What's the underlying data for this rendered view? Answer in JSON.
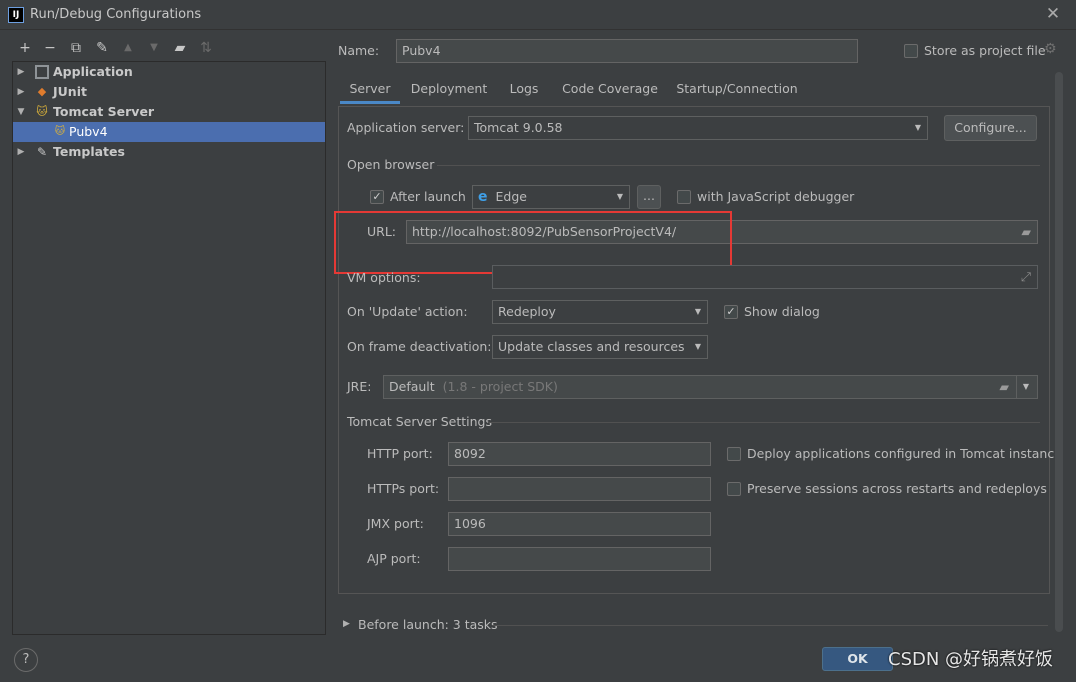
{
  "window": {
    "title": "Run/Debug Configurations",
    "app_icon_text": "IJ"
  },
  "toolbar": {
    "add": "+",
    "remove": "−",
    "copy": "⧉",
    "edit": "✎",
    "up": "▲",
    "down": "▼",
    "folder": "▰",
    "sort": "⇅"
  },
  "tree": {
    "items": [
      {
        "label": "Application",
        "arrow": "▶"
      },
      {
        "label": "JUnit",
        "arrow": "▶"
      },
      {
        "label": "Tomcat Server",
        "arrow": "▼"
      },
      {
        "label": "Pubv4"
      },
      {
        "label": "Templates",
        "arrow": "▶"
      }
    ]
  },
  "name_field": {
    "label": "Name:",
    "value": "Pubv4"
  },
  "store_as_project": {
    "label": "Store as project file",
    "checked": false
  },
  "tabs": [
    "Server",
    "Deployment",
    "Logs",
    "Code Coverage",
    "Startup/Connection"
  ],
  "server": {
    "app_server_label": "Application server:",
    "app_server_value": "Tomcat 9.0.58",
    "configure_label": "Configure...",
    "open_browser_label": "Open browser",
    "after_launch_label": "After launch",
    "browser_value": "Edge",
    "ellipsis_label": "...",
    "js_debugger_label": "with JavaScript debugger",
    "url_label": "URL:",
    "url_value": "http://localhost:8092/PubSensorProjectV4/",
    "vm_options_label": "VM options:",
    "on_update_label": "On 'Update' action:",
    "on_update_value": "Redeploy",
    "show_dialog_label": "Show dialog",
    "on_frame_label": "On frame deactivation:",
    "on_frame_value": "Update classes and resources",
    "jre_label": "JRE:",
    "jre_value": "Default",
    "jre_hint": "(1.8 - project SDK)",
    "tomcat_settings_label": "Tomcat Server Settings",
    "http_port_label": "HTTP port:",
    "http_port_value": "8092",
    "https_port_label": "HTTPs port:",
    "https_port_value": "",
    "jmx_port_label": "JMX port:",
    "jmx_port_value": "1096",
    "ajp_port_label": "AJP port:",
    "ajp_port_value": "",
    "deploy_apps_label": "Deploy applications configured in Tomcat instance",
    "preserve_sessions_label": "Preserve sessions across restarts and redeploys"
  },
  "before_launch": {
    "label": "Before launch: 3 tasks"
  },
  "footer": {
    "help": "?",
    "ok_label": "OK"
  },
  "watermark": "CSDN @好锅煮好饭",
  "colors": {
    "accent": "#4a88c7",
    "selection": "#4b6eaf",
    "highlight_box": "#e53935",
    "ok_button": "#365880"
  }
}
